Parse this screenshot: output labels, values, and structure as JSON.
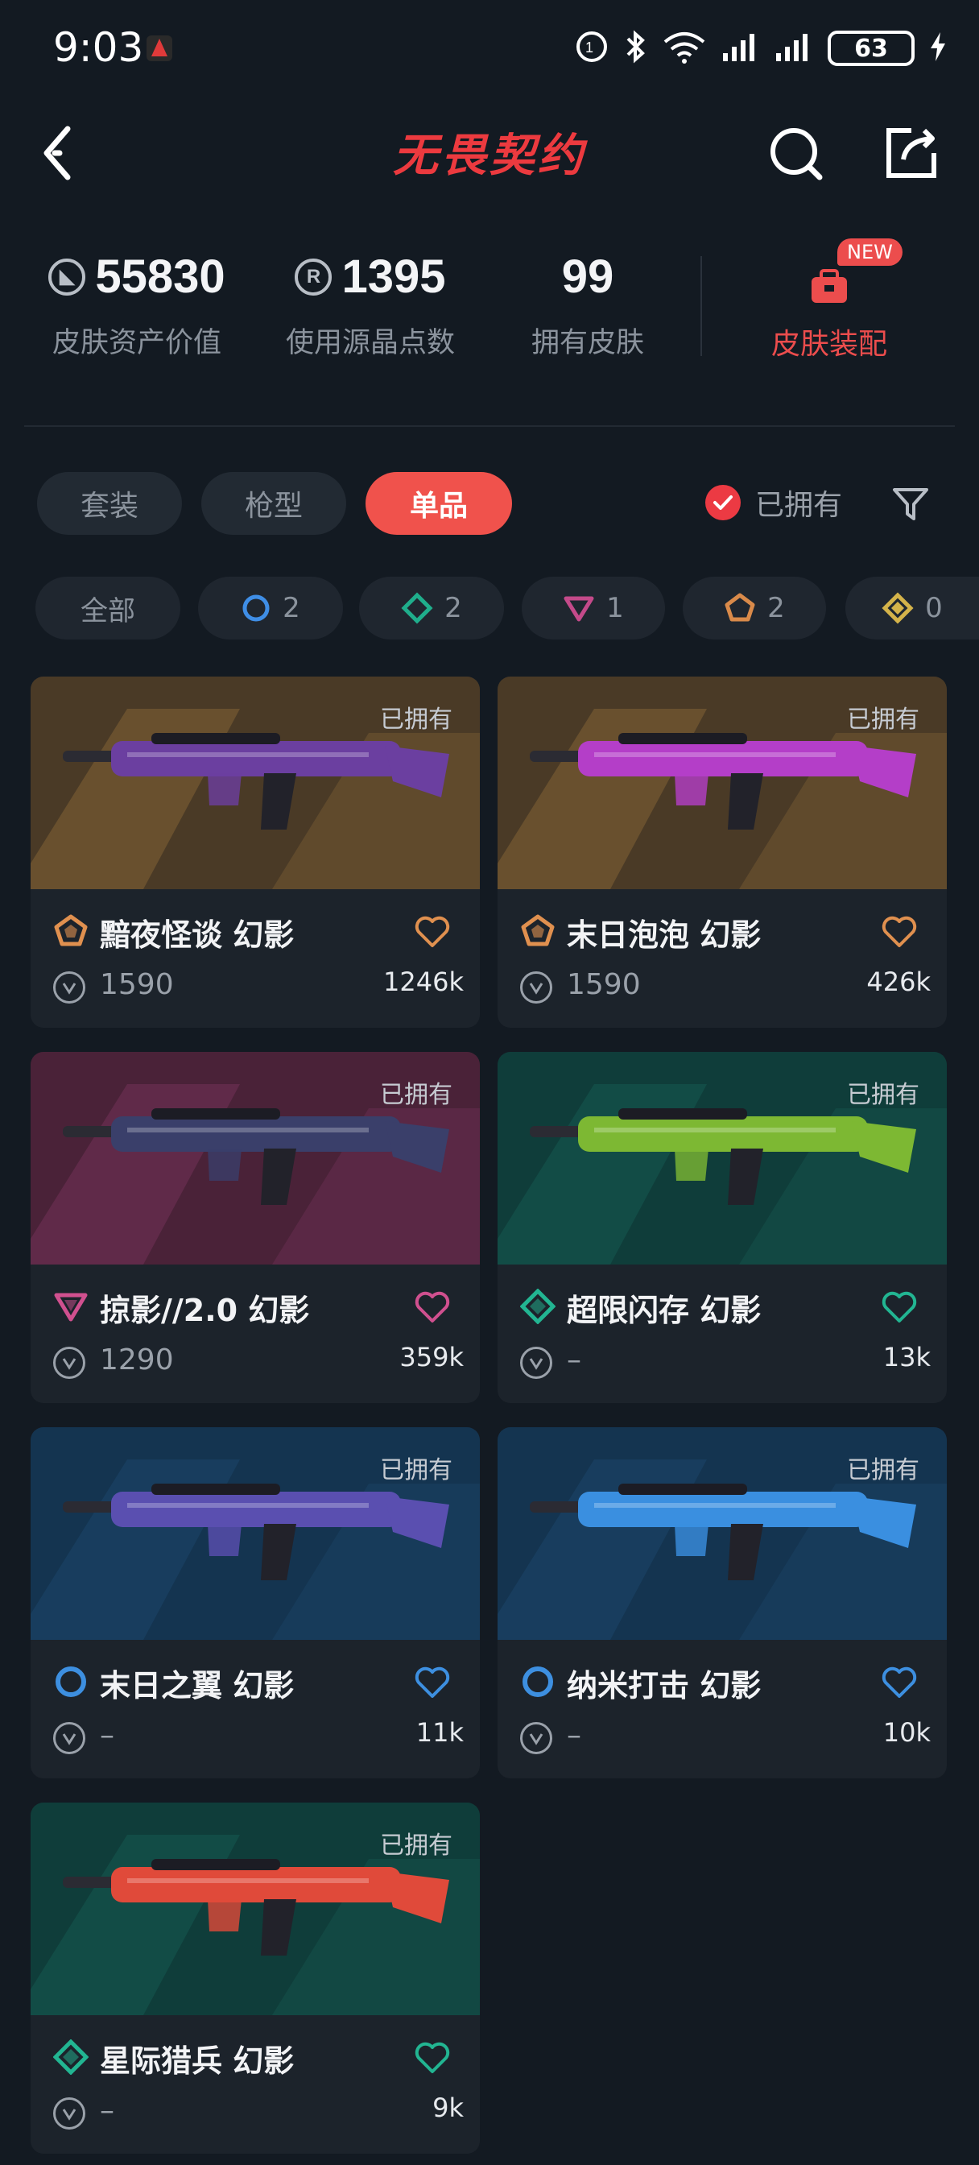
{
  "status": {
    "time": "9:03",
    "battery": "63"
  },
  "header": {
    "title": "无畏契约"
  },
  "stats": [
    {
      "value": "55830",
      "label": "皮肤资产价值",
      "icon": "vp-coin"
    },
    {
      "value": "1395",
      "label": "使用源晶点数",
      "icon": "radianite-coin"
    },
    {
      "value": "99",
      "label": "拥有皮肤"
    }
  ],
  "equip": {
    "label": "皮肤装配",
    "badge": "NEW"
  },
  "tabs": [
    "套装",
    "枪型",
    "单品"
  ],
  "owned_filter": {
    "label": "已拥有"
  },
  "chips": [
    {
      "label": "全部"
    },
    {
      "count": "2",
      "tier": "select",
      "color": "#3f8ee6"
    },
    {
      "count": "2",
      "tier": "deluxe",
      "color": "#1fae8c"
    },
    {
      "count": "1",
      "tier": "premium",
      "color": "#c44a8a"
    },
    {
      "count": "2",
      "tier": "exclusive",
      "color": "#d98a4a"
    },
    {
      "count": "0",
      "tier": "ultra",
      "color": "#d4b34a"
    }
  ],
  "cards": [
    {
      "name": "黯夜怪谈 幻影",
      "price": "1590",
      "likes": "1246k",
      "owned": "已拥有",
      "tier_color": "#e0904f",
      "tier_shape": "pentagon",
      "bg": "#4a3a26",
      "accent": "#a27a3e",
      "gun": "#6b3fa0"
    },
    {
      "name": "末日泡泡 幻影",
      "price": "1590",
      "likes": "426k",
      "owned": "已拥有",
      "tier_color": "#e0904f",
      "tier_shape": "pentagon",
      "bg": "#4a3a26",
      "accent": "#a27a3e",
      "gun": "#b43ec8"
    },
    {
      "name": "掠影//2.0 幻影",
      "price": "1290",
      "likes": "359k",
      "owned": "已拥有",
      "tier_color": "#d0508f",
      "tier_shape": "triangle",
      "bg": "#4a2238",
      "accent": "#8a3a6a",
      "gun": "#3a3f6a"
    },
    {
      "name": "超限闪存 幻影",
      "price": "–",
      "likes": "13k",
      "owned": "已拥有",
      "tier_color": "#22b592",
      "tier_shape": "diamond",
      "bg": "#0f3d3a",
      "accent": "#1a6a5e",
      "gun": "#7db833"
    },
    {
      "name": "末日之翼 幻影",
      "price": "–",
      "likes": "11k",
      "owned": "已拥有",
      "tier_color": "#3d8fe0",
      "tier_shape": "circle",
      "bg": "#143450",
      "accent": "#1f4f78",
      "gun": "#5a4fb0"
    },
    {
      "name": "纳米打击 幻影",
      "price": "–",
      "likes": "10k",
      "owned": "已拥有",
      "tier_color": "#3d8fe0",
      "tier_shape": "circle",
      "bg": "#143450",
      "accent": "#1f4f78",
      "gun": "#3a8fe0"
    },
    {
      "name": "星际猎兵 幻影",
      "price": "–",
      "likes": "9k",
      "owned": "已拥有",
      "tier_color": "#22b592",
      "tier_shape": "diamond",
      "bg": "#0f3d3a",
      "accent": "#1a6a5e",
      "gun": "#e04a3a"
    }
  ]
}
